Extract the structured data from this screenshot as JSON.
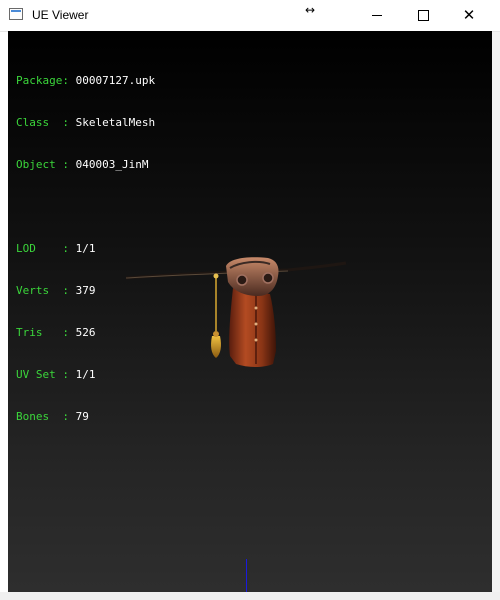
{
  "window": {
    "title": "UE Viewer",
    "controls": {
      "minimize": "minimize",
      "maximize": "maximize",
      "close": "close"
    }
  },
  "info": {
    "package_label": "Package: ",
    "package_value": "00007127.upk",
    "class_label": "Class  : ",
    "class_value": "SkeletalMesh",
    "object_label": "Object : ",
    "object_value": "040003_JinM",
    "lod_label": "LOD    : ",
    "lod_value": "1/1",
    "verts_label": "Verts  : ",
    "verts_value": "379",
    "tris_label": "Tris   : ",
    "tris_value": "526",
    "uvset_label": "UV Set : ",
    "uvset_value": "1/1",
    "bones_label": "Bones  : ",
    "bones_value": "79"
  },
  "colors": {
    "label_green": "#3bd63b",
    "value_white": "#ffffff",
    "axis_blue": "#1a1add"
  },
  "icons": {
    "app": "ue-viewer-app-icon",
    "resize": "resize-horizontal-icon"
  }
}
